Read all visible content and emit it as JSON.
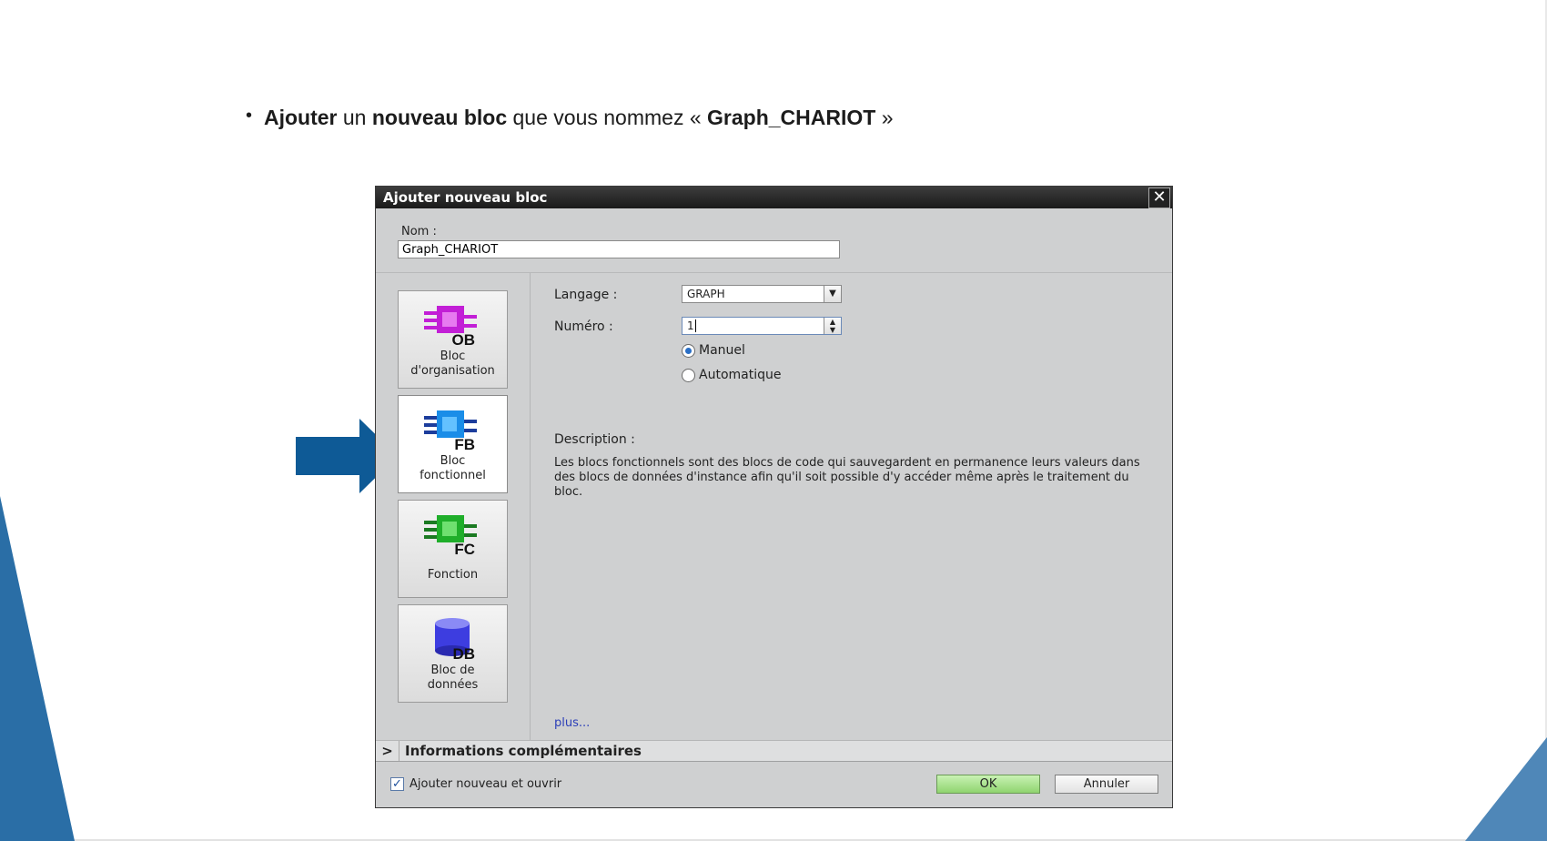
{
  "instruction": {
    "w1": "Ajouter",
    "t1": " un ",
    "w2": "nouveau bloc",
    "t2": " que vous nommez « ",
    "w3": "Graph_CHARIOT",
    "t3": " »"
  },
  "dialog": {
    "title": "Ajouter nouveau bloc",
    "name_label": "Nom :",
    "name_value": "Graph_CHARIOT",
    "blocks": [
      {
        "code": "OB",
        "line1": "Bloc",
        "line2": "d'organisation",
        "icon": "ob-block-icon",
        "color": "#c21fd6"
      },
      {
        "code": "FB",
        "line1": "Bloc",
        "line2": "fonctionnel",
        "icon": "fb-block-icon",
        "color": "#1a8de8"
      },
      {
        "code": "FC",
        "line1": "Fonction",
        "line2": "",
        "icon": "fc-block-icon",
        "color": "#1fae2a"
      },
      {
        "code": "DB",
        "line1": "Bloc de",
        "line2": "données",
        "icon": "db-block-icon",
        "color": "#3d3de0"
      }
    ],
    "selected_block": "FB",
    "language_label": "Langage :",
    "language_value": "GRAPH",
    "number_label": "Numéro :",
    "number_value": "1",
    "radio_manual": "Manuel",
    "radio_auto": "Automatique",
    "radio_selected": "Manuel",
    "description_label": "Description :",
    "description_text": "Les blocs fonctionnels sont des blocs de code qui sauvegardent en permanence leurs valeurs dans des blocs de données d'instance afin qu'il soit possible d'y accéder même après le traitement du bloc.",
    "more_link": "plus...",
    "info_label": "Informations complémentaires",
    "add_open_label": "Ajouter nouveau et ouvrir",
    "add_open_checked": true,
    "ok_label": "OK",
    "cancel_label": "Annuler"
  },
  "colors": {
    "accent_blue": "#0e5a96",
    "ok_green": "#8fd46f"
  }
}
